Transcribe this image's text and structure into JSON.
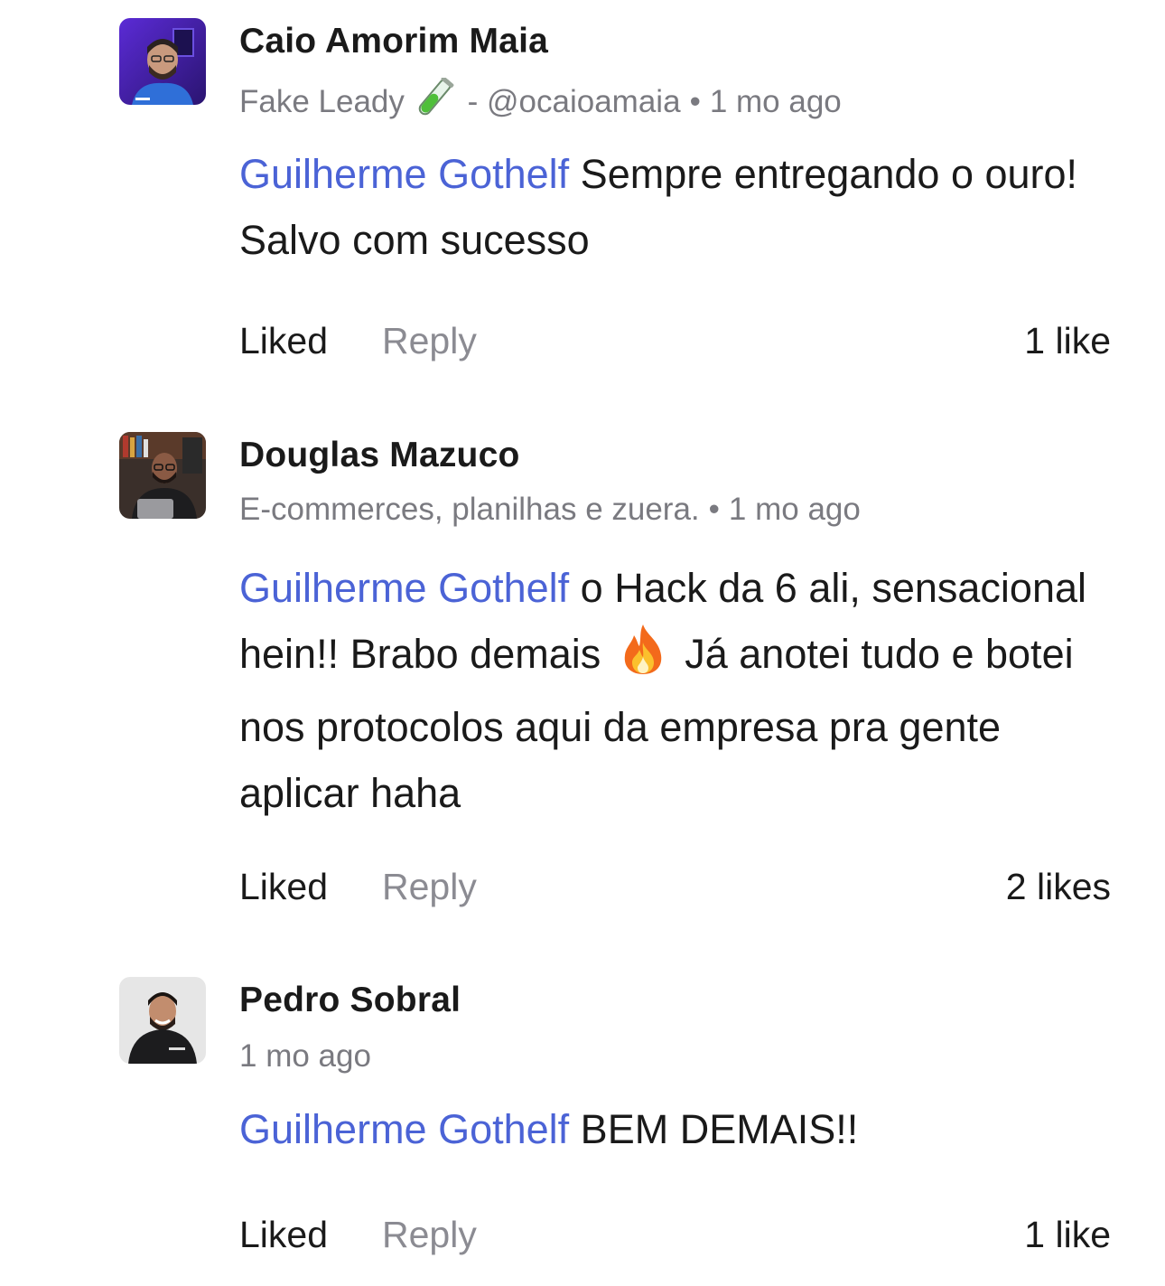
{
  "comments": [
    {
      "author": "Caio Amorim Maia",
      "headline": "Fake Leady",
      "headline_icon": "test-tube-icon",
      "handle": "- @ocaioamaia",
      "separator": "•",
      "time": "1 mo ago",
      "mention": "Guilherme Gothelf",
      "text": " Sempre entregando o ouro! Salvo com sucesso",
      "liked_label": "Liked",
      "reply_label": "Reply",
      "likes": "1 like"
    },
    {
      "author": "Douglas Mazuco",
      "headline": "E-commerces, planilhas e zuera.",
      "separator": "•",
      "time": "1 mo ago",
      "mention": "Guilherme Gothelf",
      "text_part1": " o Hack da 6 ali, sensacional hein!! Brabo demais",
      "emoji_icon": "fire-icon",
      "text_part2": " Já anotei tudo e botei nos protocolos aqui da empresa pra gente aplicar haha",
      "liked_label": "Liked",
      "reply_label": "Reply",
      "likes": "2 likes"
    },
    {
      "author": "Pedro Sobral",
      "time": "1 mo ago",
      "mention": "Guilherme Gothelf",
      "text": " BEM DEMAIS!!",
      "liked_label": "Liked",
      "reply_label": "Reply",
      "likes": "1 like"
    }
  ],
  "colors": {
    "mention": "#4b63d6",
    "meta": "#7a7a80",
    "reply": "#8b8b92",
    "text": "#1a1a1a"
  }
}
